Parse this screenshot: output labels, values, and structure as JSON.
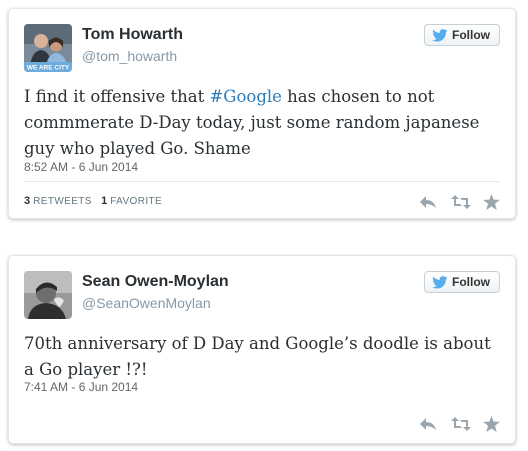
{
  "colors": {
    "hashtag": "#2b7bb9",
    "handle": "#8899a6",
    "twitter_blue": "#55acee",
    "action_icons": "#9aa5ad"
  },
  "tweets": [
    {
      "name": "Tom Howarth",
      "handle": "@tom_howarth",
      "follow_label": "Follow",
      "avatar_caption": "WE ARE CITY",
      "text_before": "I find it offensive that ",
      "hashtag": "#Google",
      "text_after": " has chosen to not commmerate D-Day today, just some random japanese guy who played Go. Shame",
      "timestamp": "8:52 AM - 6 Jun 2014",
      "retweet_count": "3",
      "retweet_label": "RETWEETS",
      "favorite_count": "1",
      "favorite_label": "FAVORITE",
      "icons": [
        "reply-icon",
        "retweet-icon",
        "favorite-star-icon"
      ]
    },
    {
      "name": "Sean Owen-Moylan",
      "handle": "@SeanOwenMoylan",
      "follow_label": "Follow",
      "text": "70th anniversary of D Day and Google’s doodle is about a Go player !?!",
      "timestamp": "7:41 AM - 6 Jun 2014",
      "icons": [
        "reply-icon",
        "retweet-icon",
        "favorite-star-icon"
      ]
    }
  ]
}
